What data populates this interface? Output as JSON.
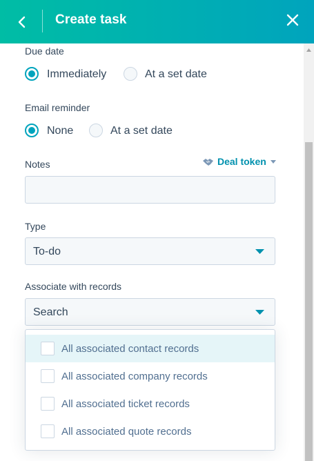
{
  "header": {
    "title": "Create task"
  },
  "due_date": {
    "label": "Due date",
    "options": [
      {
        "label": "Immediately",
        "checked": true
      },
      {
        "label": "At a set date",
        "checked": false
      }
    ]
  },
  "email_reminder": {
    "label": "Email reminder",
    "options": [
      {
        "label": "None",
        "checked": true
      },
      {
        "label": "At a set date",
        "checked": false
      }
    ]
  },
  "notes": {
    "label": "Notes",
    "token_link": "Deal token",
    "value": ""
  },
  "type": {
    "label": "Type",
    "selected": "To-do"
  },
  "associate": {
    "label": "Associate with records",
    "placeholder": "Search",
    "options": [
      {
        "label": "All associated contact records",
        "checked": false,
        "highlighted": true
      },
      {
        "label": "All associated company records",
        "checked": false
      },
      {
        "label": "All associated ticket records",
        "checked": false
      },
      {
        "label": "All associated quote records",
        "checked": false
      }
    ]
  },
  "colors": {
    "header_start": "#00bda5",
    "header_end": "#00a4bd",
    "accent": "#00a4bd",
    "link": "#0091ae",
    "text": "#33475b"
  },
  "icons": [
    "chevron-left-icon",
    "close-icon",
    "handshake-icon",
    "caret-down-icon",
    "scroll-up-arrow-icon"
  ]
}
